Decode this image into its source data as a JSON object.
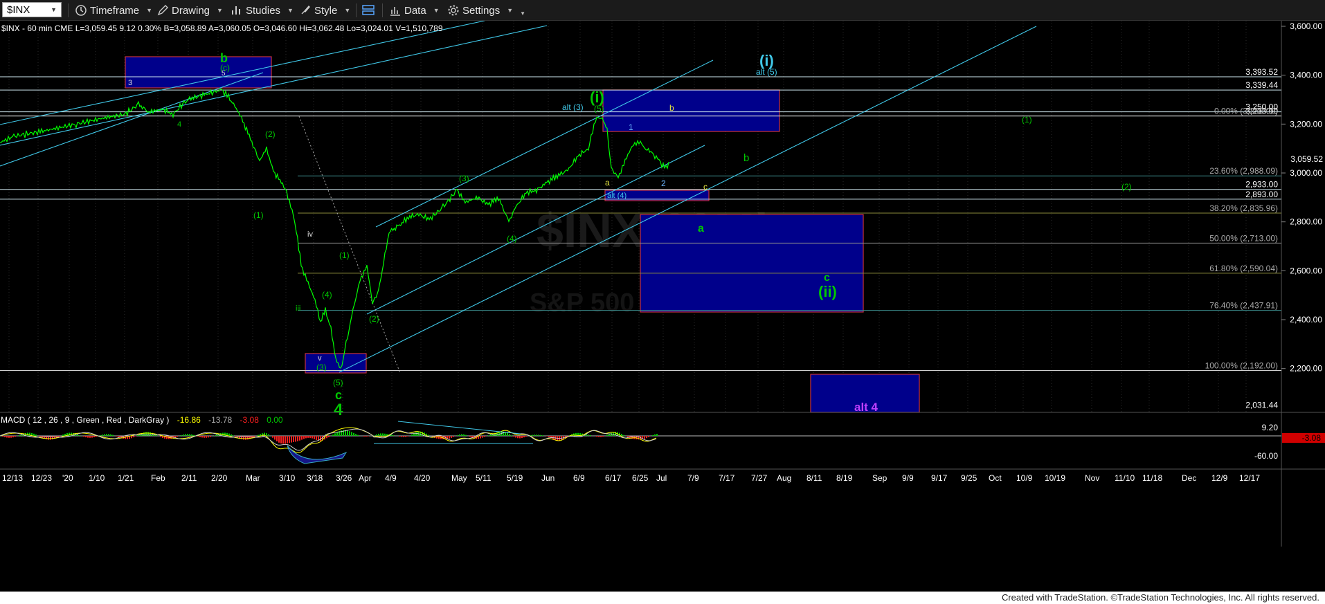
{
  "toolbar": {
    "symbol": "$INX",
    "timeframe": "Timeframe",
    "drawing": "Drawing",
    "studies": "Studies",
    "style": "Style",
    "data": "Data",
    "settings": "Settings"
  },
  "chart": {
    "header": "$INX - 60 min CME  L=3,059.45 9.12  0.30%   B=3,058.89  A=3,060.05  O=3,046.60  Hi=3,062.48  Lo=3,024.01  V=1,510,789",
    "watermark": "$INX-60Min",
    "watermark_sub": "S&P 500",
    "price_ticks": [
      "3,600.00",
      "3,400.00",
      "3,200.00",
      "3,000.00",
      "2,800.00",
      "2,600.00",
      "2,400.00",
      "2,200.00"
    ],
    "horizontal_levels": [
      {
        "label": "3,393.52",
        "value": 3393.52
      },
      {
        "label": "3,339.44",
        "value": 3339.44
      },
      {
        "label": "3,250.00",
        "value": 3250
      },
      {
        "label": "3,233.00",
        "value": 3233
      },
      {
        "label": "2,933.00",
        "value": 2933
      },
      {
        "label": "2,893.00",
        "value": 2893
      },
      {
        "label": "2,031.44",
        "value": 2031.44
      }
    ],
    "fib_levels": [
      {
        "label": "0.00% (3,233.00)",
        "value": 3233
      },
      {
        "label": "23.60% (2,988.09)",
        "value": 2988.09
      },
      {
        "label": "38.20% (2,835.96)",
        "value": 2835.96
      },
      {
        "label": "50.00% (2,713.00)",
        "value": 2713
      },
      {
        "label": "61.80% (2,590.04)",
        "value": 2590.04
      },
      {
        "label": "76.40% (2,437.91)",
        "value": 2437.91
      },
      {
        "label": "100.00% (2,192.00)",
        "value": 2192
      }
    ],
    "last_price": "3,059.52",
    "wave_labels": {
      "b_top": "b",
      "c_paren": "(c)",
      "five_top": "5",
      "three_left": "3",
      "four_left": "4",
      "w2": "(2)",
      "w1": "(1)",
      "iv": "iv",
      "iii": "iii",
      "v": "v",
      "w3": "(3)",
      "w5": "(5)",
      "c_low": "c",
      "four_low": "4",
      "w1b": "(1)",
      "w4b": "(4)",
      "w2b": "(2)",
      "w3c": "(3)",
      "w4c": "(4)",
      "i_green": "(i)",
      "w5c": "(5)",
      "alt3": "alt (3)",
      "one_blue": "1",
      "b_yellow": "b",
      "a_yellow": "a",
      "two_blue": "2",
      "c_yellow": "c",
      "alt4_small": "alt (4)",
      "i_cyan": "(i)",
      "alt5": "alt (5)",
      "b_green": "b",
      "a_green": "a",
      "c_green": "c",
      "ii": "(ii)",
      "one_far": "(1)",
      "two_far": "(2)",
      "alt4_big": "alt 4"
    },
    "macd_header": "MACD ( 12 , 26 , 9 , Green , Red , DarkGray )",
    "macd_values": [
      "-16.86",
      "-13.78",
      "-3.08",
      "0.00"
    ],
    "macd_ticks": [
      "9.20",
      "-60.00"
    ],
    "macd_last": "-3.08",
    "date_ticks": [
      "12/13",
      "12/23",
      "'20",
      "1/10",
      "1/21",
      "Feb",
      "2/11",
      "2/20",
      "Mar",
      "3/10",
      "3/18",
      "3/26",
      "Apr",
      "4/9",
      "4/20",
      "May",
      "5/11",
      "5/19",
      "Jun",
      "6/9",
      "6/17",
      "6/25",
      "Jul",
      "7/9",
      "7/17",
      "7/27",
      "Aug",
      "8/11",
      "8/19",
      "Sep",
      "9/9",
      "9/17",
      "9/25",
      "Oct",
      "10/9",
      "10/19",
      "Nov",
      "11/10",
      "11/18",
      "Dec",
      "12/9",
      "12/17"
    ]
  },
  "footer": "Created with TradeStation. ©TradeStation Technologies, Inc. All rights reserved.",
  "colors": {
    "bg": "#000000",
    "price": "#00ff00",
    "cyan": "#40c8e8",
    "box_fill": "#00008b",
    "box_border": "#c8323c",
    "fib": "#c8c864",
    "magenta": "#c040ff"
  }
}
